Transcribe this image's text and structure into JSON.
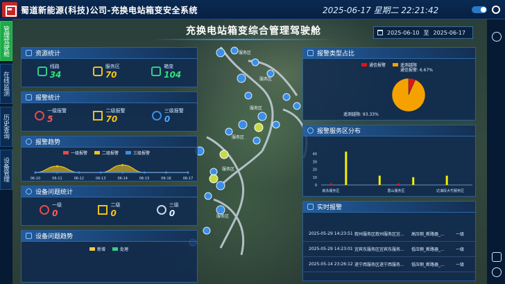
{
  "header": {
    "title": "蜀道新能源(科技)公司-充换电站箱变安全系统",
    "clock": "2025-06-17 星期二 22:21:42"
  },
  "leftnav": [
    {
      "label": "管理驾驶舱",
      "active": true
    },
    {
      "label": "在线监测",
      "active": false
    },
    {
      "label": "历史查询",
      "active": false
    },
    {
      "label": "设备管理",
      "active": false
    }
  ],
  "main_title": "充换电站箱变综合管理驾驶舱",
  "date_range": {
    "start": "2025-06-10",
    "sep": "至",
    "end": "2025-06-17"
  },
  "resource_stats": {
    "title": "资源统计",
    "items": [
      {
        "label": "线路",
        "value": "34",
        "icon": "route-icon"
      },
      {
        "label": "服务区",
        "value": "70",
        "icon": "building-icon"
      },
      {
        "label": "箱变",
        "value": "104",
        "icon": "box-icon"
      }
    ]
  },
  "alarm_stats": {
    "title": "报警统计",
    "items": [
      {
        "label": "一级报警",
        "value": "5",
        "icon": "alert-red-icon"
      },
      {
        "label": "二级报警",
        "value": "70",
        "icon": "alert-yellow-icon"
      },
      {
        "label": "三级报警",
        "value": "0",
        "icon": "alert-blue-icon"
      }
    ]
  },
  "alarm_trend": {
    "title": "报警趋势",
    "legend": [
      "一级报警",
      "二级报警",
      "三级报警"
    ],
    "colors": [
      "#e84a4a",
      "#f0c21a",
      "#3a8ee8"
    ]
  },
  "device_stats": {
    "title": "设备问题统计",
    "items": [
      {
        "label": "一级",
        "value": "0",
        "icon": "alert-red-icon"
      },
      {
        "label": "二级",
        "value": "0",
        "icon": "alert-yellow-icon"
      },
      {
        "label": "三级",
        "value": "0",
        "icon": "alert-white-icon"
      }
    ]
  },
  "device_trend": {
    "title": "设备问题趋势",
    "legend": [
      "新增",
      "处理"
    ],
    "colors": [
      "#f5c84a",
      "#2fd08a"
    ]
  },
  "alarm_type": {
    "title": "报警类型占比",
    "legend": [
      "通信报警",
      "遥测越限"
    ],
    "colors": [
      "#e8101a",
      "#f5a200"
    ],
    "label_comm": "通信报警: 6.67%",
    "label_tele": "遥测越限: 93.33%"
  },
  "alarm_area": {
    "title": "报警服务区分布"
  },
  "realtime_alarm": {
    "title": "实时报警",
    "rows": [
      {
        "time": "2025-05-29 14:23:51",
        "place": "叙州服务区叙州服务区宜...",
        "desc": "高压侧_断路器_...",
        "level": "一级"
      },
      {
        "time": "2025-05-29 14:23:01",
        "place": "宜宾东服务区宜宾东服务...",
        "desc": "低压侧_断路器_...",
        "level": "一级"
      },
      {
        "time": "2025-05-14 23:26:12",
        "place": "遂宁西服务区遂宁西服务...",
        "desc": "低压侧_断路器_...",
        "level": "一级"
      }
    ]
  },
  "map_labels": [
    "服务区",
    "服务区",
    "服务区",
    "服务区",
    "服务区",
    "服务区"
  ],
  "chart_data": [
    {
      "type": "line",
      "title": "报警趋势",
      "x": [
        "06-10",
        "06-11",
        "06-12",
        "06-13",
        "06-14",
        "06-15",
        "06-16",
        "06-17"
      ],
      "series": [
        {
          "name": "一级报警",
          "values": [
            0,
            0,
            0,
            0,
            0,
            0,
            0,
            0
          ]
        },
        {
          "name": "二级报警",
          "values": [
            0,
            5,
            0,
            0,
            6,
            0,
            0,
            0
          ]
        },
        {
          "name": "三级报警",
          "values": [
            0,
            0,
            0,
            0,
            0,
            0,
            0,
            0
          ]
        }
      ],
      "grid": false,
      "legend": "top"
    },
    {
      "type": "pie",
      "title": "报警类型占比",
      "categories": [
        "通信报警",
        "遥测越限"
      ],
      "values": [
        6.67,
        93.33
      ],
      "legend": "top"
    },
    {
      "type": "bar",
      "title": "报警服务区分布",
      "categories": [
        "叙永服务区",
        "眉山服务区",
        "达濠段大竹服务区"
      ],
      "series": [
        {
          "values": [
            0,
            43,
            0,
            12,
            0,
            10,
            0,
            12,
            0
          ]
        },
        {
          "values": [
            2,
            0,
            0,
            0,
            2,
            0,
            0,
            0,
            0
          ]
        }
      ],
      "ylim": [
        0,
        50
      ],
      "yticks": [
        0,
        10,
        20,
        30,
        40
      ]
    }
  ]
}
